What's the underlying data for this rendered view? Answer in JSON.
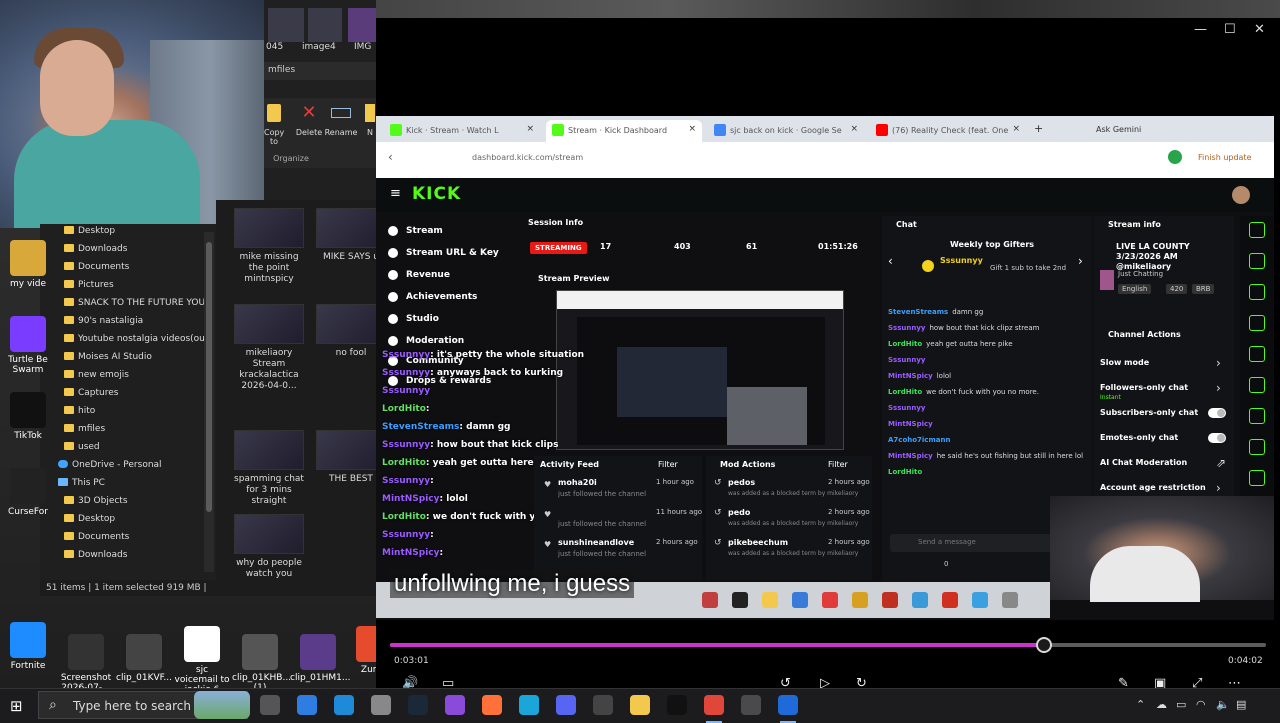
{
  "explorer": {
    "path_label": "mfiles",
    "top_items": [
      "045",
      "image4",
      "IMG"
    ],
    "ribbon": [
      "Copy to",
      "Delete",
      "Rename",
      "N"
    ],
    "ribbon_group": "Organize",
    "nav_items": [
      {
        "label": "Desktop",
        "type": "folder"
      },
      {
        "label": "Downloads",
        "type": "folder"
      },
      {
        "label": "Documents",
        "type": "folder"
      },
      {
        "label": "Pictures",
        "type": "folder"
      },
      {
        "label": "SNACK TO THE FUTURE YOUT",
        "type": "folder"
      },
      {
        "label": "90's nastaligia",
        "type": "folder"
      },
      {
        "label": "Youtube nostalgia videos(our",
        "type": "folder"
      },
      {
        "label": "Moises AI Studio",
        "type": "folder"
      },
      {
        "label": "new emojis",
        "type": "folder"
      },
      {
        "label": "Captures",
        "type": "folder"
      },
      {
        "label": "hito",
        "type": "folder"
      },
      {
        "label": "mfiles",
        "type": "folder"
      },
      {
        "label": "used",
        "type": "folder"
      },
      {
        "label": "OneDrive - Personal",
        "type": "onedrive"
      },
      {
        "label": "This PC",
        "type": "pc"
      },
      {
        "label": "3D Objects",
        "type": "folder"
      },
      {
        "label": "Desktop",
        "type": "folder"
      },
      {
        "label": "Documents",
        "type": "folder"
      },
      {
        "label": "Downloads",
        "type": "folder"
      }
    ],
    "files": [
      {
        "label": "mike missing the point mintnspicy"
      },
      {
        "label": "MIKE SAYS u"
      },
      {
        "label": "mikeliaory Stream krackalactica 2026-04-0..."
      },
      {
        "label": "no fool"
      },
      {
        "label": "spamming chat for 3 mins straight"
      },
      {
        "label": "THE BEST"
      },
      {
        "label": "why do people watch you"
      }
    ],
    "status": "51 items  |  1 item selected  919 MB  |"
  },
  "desktop_icons": [
    {
      "label": "my vide",
      "color": "#d9a83a"
    },
    {
      "label": "Turtle Be Swarm",
      "color": "#7a3cff"
    },
    {
      "label": "TikTok",
      "color": "#111111"
    },
    {
      "label": "CurseFor",
      "color": "#222222"
    },
    {
      "label": "Fortnite",
      "color": "#1e8cff"
    },
    {
      "label": "Screenshot 2026-07-...",
      "color": "#333333"
    },
    {
      "label": "clip_01KVF...",
      "color": "#444444"
    },
    {
      "label": "sjc voicemail to jackie 6",
      "color": "#ffffff"
    },
    {
      "label": "clip_01KHB... (1)",
      "color": "#555555"
    },
    {
      "label": "clip_01HM1...",
      "color": "#5a3c8a"
    },
    {
      "label": "Zuma",
      "color": "#e54b2c"
    }
  ],
  "player": {
    "window_controls": [
      "—",
      "☐",
      "✕"
    ],
    "caption": "unfollwing me, i guess",
    "time_current": "0:03:01",
    "time_total": "0:04:02",
    "progress": 0.747,
    "accent": "#cc33cc"
  },
  "browser": {
    "tabs": [
      {
        "label": "Kick · Stream · Watch L",
        "fav": "#53fc18"
      },
      {
        "label": "Stream · Kick Dashboard",
        "fav": "#53fc18"
      },
      {
        "label": "sjc back on kick · Google Se",
        "fav": "#4285f4"
      },
      {
        "label": "(76) Reality Check (feat. One",
        "fav": "#ff0000"
      }
    ],
    "ask": "Ask Gemini",
    "url": "dashboard.kick.com/stream",
    "finish_update": "Finish update"
  },
  "kick": {
    "logo": "KICK",
    "nav": [
      "Stream",
      "Stream URL & Key",
      "Revenue",
      "Achievements",
      "Studio",
      "Moderation",
      "Community",
      "Drops & rewards"
    ],
    "session_title": "Session Info",
    "streaming": "STREAMING",
    "session_values": [
      "17",
      "403",
      "61",
      "01:51:26"
    ],
    "preview_title": "Stream Preview",
    "chat_title": "Chat",
    "gifters_title": "Weekly top Gifters",
    "top_gifter": "Sssunnyy",
    "gift_text": "Gift 1 sub to take 2nd",
    "stream_info_title": "Stream info",
    "stream_title": "LIVE LA COUNTY 3/23/2026 AM @mikeliaory",
    "category": "Just Chatting",
    "tags": [
      "English",
      "420",
      "BRB"
    ],
    "channel_actions_title": "Channel Actions",
    "channel_actions": [
      {
        "label": "Slow mode",
        "kind": "arrow"
      },
      {
        "label": "Followers-only chat",
        "kind": "arrow",
        "sub": "Instant"
      },
      {
        "label": "Subscribers-only chat",
        "kind": "toggle"
      },
      {
        "label": "Emotes-only chat",
        "kind": "toggle"
      },
      {
        "label": "AI Chat Moderation",
        "kind": "ext"
      },
      {
        "label": "Account age restriction",
        "kind": "arrow"
      }
    ],
    "activity_title": "Activity Feed",
    "activity_filter": "Filter",
    "activity": [
      {
        "user": "moha20i",
        "text": "just followed the channel",
        "time": "1 hour ago"
      },
      {
        "user": "",
        "text": "just followed the channel",
        "time": "11 hours ago"
      },
      {
        "user": "sunshineandlove",
        "text": "just followed the channel",
        "time": "2 hours ago"
      }
    ],
    "mod_title": "Mod Actions",
    "mod_filter": "Filter",
    "mod_actions": [
      {
        "user": "pedos",
        "text": "was added as a blocked term by mikeliaory",
        "time": "2 hours ago"
      },
      {
        "user": "pedo",
        "text": "was added as a blocked term by mikeliaory",
        "time": "2 hours ago"
      },
      {
        "user": "pikebeechum",
        "text": "was added as a blocked term by mikeliaory",
        "time": "2 hours ago"
      }
    ],
    "send_placeholder": "Send a message",
    "chat_footer": "0"
  },
  "chat_panel": [
    {
      "user": "StevenStreams",
      "msg": "damn gg",
      "cls": "t"
    },
    {
      "user": "Sssunnyy",
      "msg": "how bout that kick clipz stream",
      "cls": ""
    },
    {
      "user": "LordHito",
      "msg": "yeah get outta here pike",
      "cls": "g"
    },
    {
      "user": "Sssunnyy",
      "msg": "",
      "cls": ""
    },
    {
      "user": "MintNSpicy",
      "msg": "lolol",
      "cls": ""
    },
    {
      "user": "LordHito",
      "msg": "we don't fuck with you no more.",
      "cls": "g"
    },
    {
      "user": "Sssunnyy",
      "msg": "",
      "cls": ""
    },
    {
      "user": "MintNSpicy",
      "msg": "",
      "cls": ""
    },
    {
      "user": "A7coho7icmann",
      "msg": "",
      "cls": "t"
    },
    {
      "user": "MintNSpicy",
      "msg": "he said he's out fishing but still in here lol",
      "cls": ""
    },
    {
      "user": "LordHito",
      "msg": "",
      "cls": "g"
    }
  ],
  "chat_overlay": [
    {
      "user": "Sssunnyy",
      "msg": ": it's petty the whole situation",
      "cls": ""
    },
    {
      "user": "Sssunnyy",
      "msg": ": anyways back to kurking",
      "cls": ""
    },
    {
      "user": "Sssunnyy",
      "msg": "",
      "cls": ""
    },
    {
      "user": "LordHito",
      "msg": ":",
      "cls": "g"
    },
    {
      "user": "StevenStreams",
      "msg": ": damn gg",
      "cls": "t"
    },
    {
      "user": "Sssunnyy",
      "msg": ": how bout that kick clips",
      "cls": ""
    },
    {
      "user": "LordHito",
      "msg": ": yeah get outta here pike",
      "cls": "g"
    },
    {
      "user": "Sssunnyy",
      "msg": ":",
      "cls": ""
    },
    {
      "user": "MintNSpicy",
      "msg": ": lolol",
      "cls": ""
    },
    {
      "user": "LordHito",
      "msg": ": we don't fuck with you no more.",
      "cls": "g"
    },
    {
      "user": "Sssunnyy",
      "msg": ":",
      "cls": ""
    },
    {
      "user": "MintNSpicy",
      "msg": ":",
      "cls": ""
    }
  ],
  "taskbar": {
    "search_placeholder": "Type here to search",
    "icons": [
      {
        "name": "task-view-icon",
        "color": "#555555"
      },
      {
        "name": "store-icon",
        "color": "#2f7de1"
      },
      {
        "name": "mail-icon",
        "color": "#1f8ad8"
      },
      {
        "name": "settings-icon",
        "color": "#888888"
      },
      {
        "name": "steam-icon",
        "color": "#1b2838"
      },
      {
        "name": "visual-studio-icon",
        "color": "#8a4bd8"
      },
      {
        "name": "firefox-icon",
        "color": "#ff7139"
      },
      {
        "name": "edge-icon",
        "color": "#1aa6d8"
      },
      {
        "name": "discord-icon",
        "color": "#5865f2"
      },
      {
        "name": "obs-icon",
        "color": "#444444"
      },
      {
        "name": "file-explorer-icon",
        "color": "#f2c94c"
      },
      {
        "name": "tiktok-icon",
        "color": "#111111"
      },
      {
        "name": "chrome-icon",
        "color": "#e0473a"
      },
      {
        "name": "xbox-icon",
        "color": "#4a4a4a"
      },
      {
        "name": "media-player-icon",
        "color": "#1e6ad8"
      }
    ]
  }
}
